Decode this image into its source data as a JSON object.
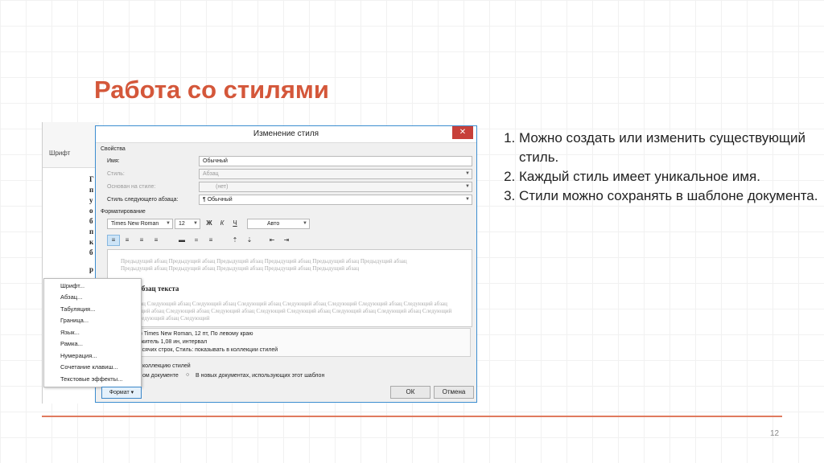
{
  "slide": {
    "title": "Работа со стилями",
    "page_number": "12",
    "points": [
      "Можно создать или изменить существующий стиль.",
      "Каждый стиль имеет уникальное имя.",
      "Стили можно сохранять в шаблоне документа."
    ]
  },
  "word": {
    "ribbon_group_label": "Шрифт",
    "doc_letters": [
      "Г",
      "п",
      "у",
      "о",
      "б",
      "п",
      "к",
      "б",
      "р",
      "п",
      "п"
    ]
  },
  "dialog": {
    "title": "Изменение стиля",
    "close_glyph": "✕",
    "properties_label": "Свойства",
    "name_label": "Имя:",
    "name_value": "Обычный",
    "style_type_label": "Стиль:",
    "style_type_value": "Абзац",
    "based_on_label": "Основан на стиле:",
    "based_on_value": "(нет)",
    "next_style_label": "Стиль следующего абзаца:",
    "next_style_value": "¶ Обычный",
    "formatting_label": "Форматирование",
    "font_value": "Times New Roman",
    "size_value": "12",
    "bold": "Ж",
    "italic": "К",
    "underline": "Ч",
    "color_value": "Авто",
    "preview_prev": "Предыдущий абзац Предыдущий абзац Предыдущий абзац Предыдущий абзац Предыдущий абзац Предыдущий абзац Предыдущий абзац Предыдущий абзац Предыдущий абзац Предыдущий абзац Предыдущий абзац",
    "preview_sample": "один абзац текста",
    "preview_next": "щий абзац Следующий абзац Следующий абзац Следующий абзац Следующий абзац Следующий Следующий абзац Следующий абзац Следующий абзац Следующий абзац Следующий абзац Следующий Следующий абзац Следующий абзац Следующий абзац Следующий абзац Следующий абзац Следующий",
    "desc_line1": "умолчанию) Times New Roman, 12 пт, По левому краю",
    "desc_line2": "очный,  множитель 1,08 ин, интервал",
    "desc_line3": "т, Запрет висячих строк, Стиль: показывать в коллекции стилей",
    "add_gallery": "коллекцию стилей",
    "only_doc": "ом документе",
    "new_docs": "В новых документах, использующих этот шаблон",
    "ok": "ОК",
    "cancel": "Отмена",
    "format_button": "Формат ▾"
  },
  "menu": {
    "items": [
      "Шрифт...",
      "Абзац...",
      "Табуляция...",
      "Граница...",
      "Язык...",
      "Рамка...",
      "Нумерация...",
      "Сочетание клавиш...",
      "Текстовые эффекты..."
    ]
  }
}
